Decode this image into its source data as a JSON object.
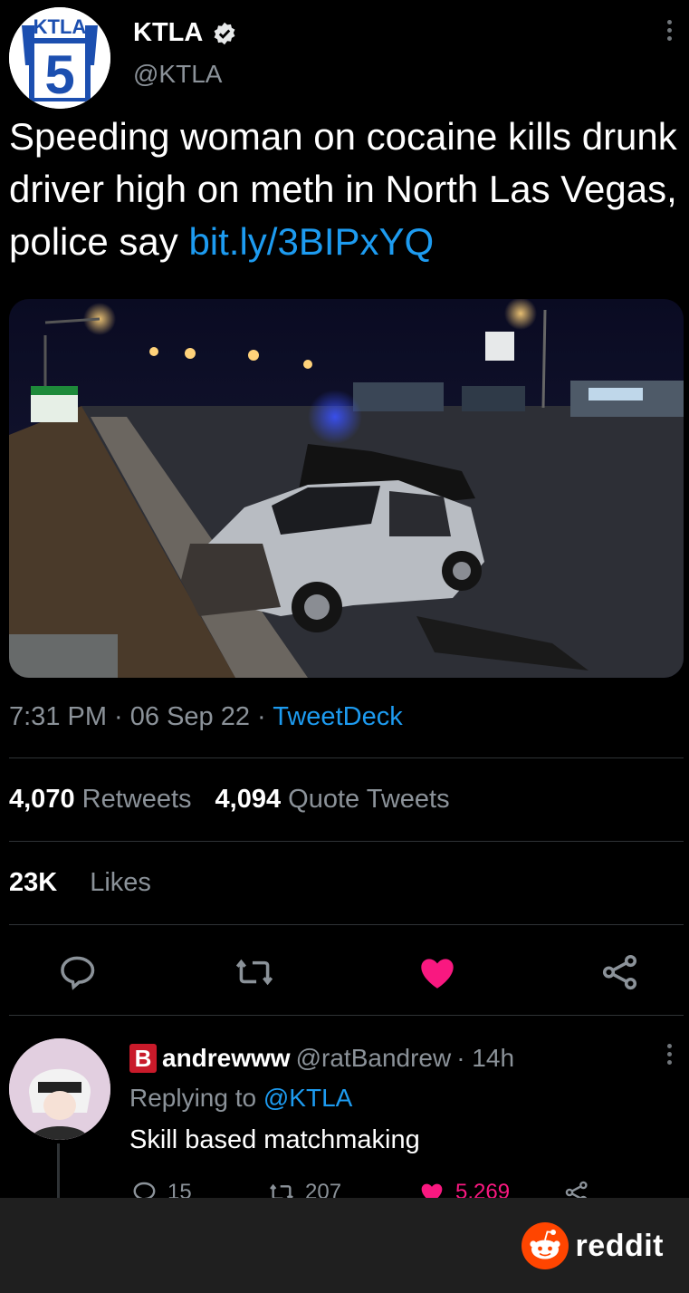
{
  "tweet": {
    "author_name": "KTLA",
    "author_handle": "@KTLA",
    "logo_text": "KTLA",
    "logo_number": "5",
    "text": "Speeding woman on cocaine kills drunk driver high on meth in North Las Vegas, police say ",
    "link": "bit.ly/3BIPxYQ",
    "time": "7:31 PM · 06 Sep 22 · ",
    "source": "TweetDeck",
    "retweets_count": "4,070",
    "retweets_label": "Retweets",
    "quotes_count": "4,094",
    "quotes_label": "Quote Tweets",
    "likes_count": "23K",
    "likes_label": "Likes"
  },
  "reply": {
    "badge": "B",
    "name": "andrewww",
    "handle": "@ratBandrew",
    "time": "· 14h",
    "replying_prefix": "Replying to ",
    "replying_to": "@KTLA",
    "text": "Skill based matchmaking",
    "reply_count": "15",
    "retweet_count": "207",
    "like_count": "5,269"
  },
  "footer": {
    "brand": "reddit"
  },
  "colors": {
    "link": "#1d9bf0",
    "like": "#f91880",
    "reddit_orange": "#ff4500"
  },
  "icons": [
    "verified-icon",
    "more-icon",
    "reply-icon",
    "retweet-icon",
    "like-icon",
    "share-icon",
    "reddit-snoo-icon"
  ]
}
